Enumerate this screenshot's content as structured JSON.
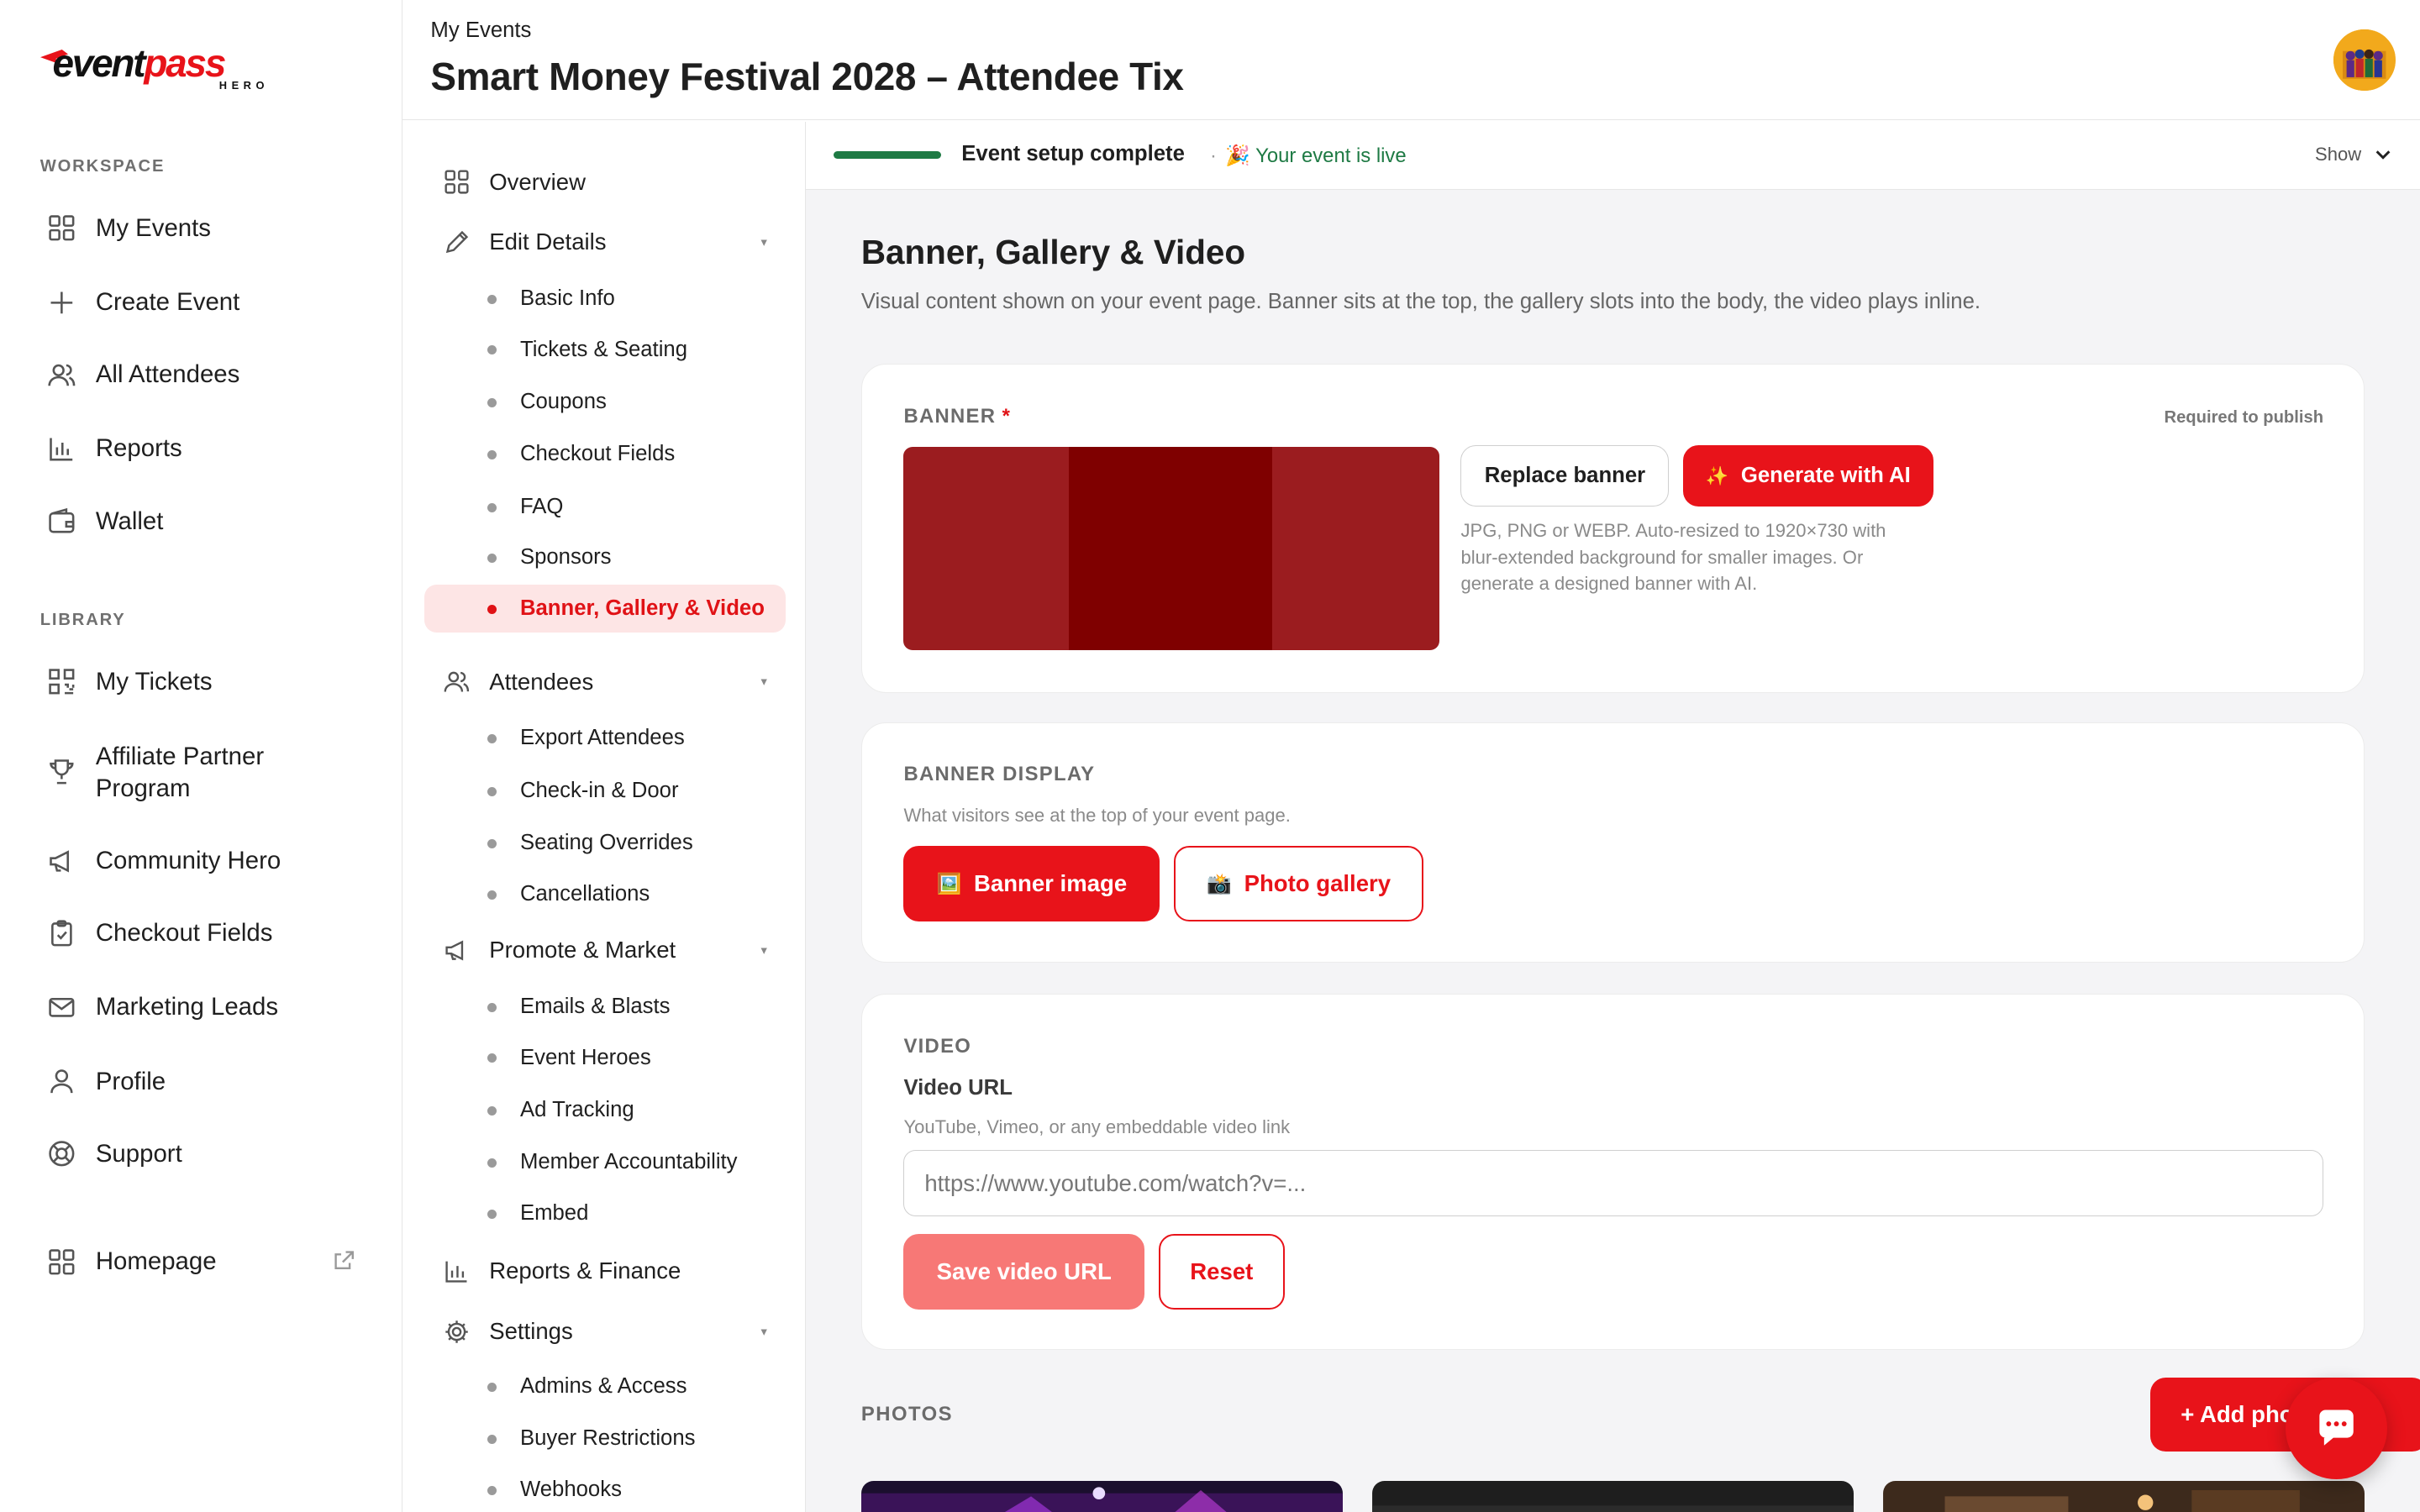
{
  "logo": {
    "part1": "event",
    "part2": "pass",
    "sub": "HERO"
  },
  "sidebar": {
    "workspace_label": "WORKSPACE",
    "workspace_items": [
      {
        "label": "My Events",
        "icon": "grid-icon"
      },
      {
        "label": "Create Event",
        "icon": "plus-icon"
      },
      {
        "label": "All Attendees",
        "icon": "users-icon"
      },
      {
        "label": "Reports",
        "icon": "bar-chart-icon"
      },
      {
        "label": "Wallet",
        "icon": "wallet-icon"
      }
    ],
    "library_label": "LIBRARY",
    "library_items": [
      {
        "label": "My Tickets",
        "icon": "qr-code-icon"
      },
      {
        "label": "Affiliate Partner Program",
        "icon": "trophy-icon"
      },
      {
        "label": "Community Hero",
        "icon": "megaphone-icon"
      },
      {
        "label": "Checkout Fields",
        "icon": "clipboard-check-icon"
      },
      {
        "label": "Marketing Leads",
        "icon": "mail-icon"
      },
      {
        "label": "Profile",
        "icon": "user-icon"
      },
      {
        "label": "Support",
        "icon": "lifebuoy-icon"
      }
    ],
    "homepage": {
      "label": "Homepage",
      "icon": "grid-icon",
      "ext_icon": "external-link-icon"
    }
  },
  "header": {
    "breadcrumb": "My Events",
    "title": "Smart Money Festival 2028 – Attendee Tix"
  },
  "subnav": {
    "overview": "Overview",
    "edit_details": {
      "label": "Edit Details",
      "items": [
        "Basic Info",
        "Tickets & Seating",
        "Coupons",
        "Checkout Fields",
        "FAQ",
        "Sponsors",
        "Banner, Gallery & Video"
      ],
      "active": "Banner, Gallery & Video"
    },
    "attendees": {
      "label": "Attendees",
      "items": [
        "Export Attendees",
        "Check-in & Door",
        "Seating Overrides",
        "Cancellations"
      ]
    },
    "promote": {
      "label": "Promote & Market",
      "items": [
        "Emails & Blasts",
        "Event Heroes",
        "Ad Tracking",
        "Member Accountability",
        "Embed"
      ]
    },
    "reports": "Reports & Finance",
    "settings": {
      "label": "Settings",
      "items": [
        "Admins & Access",
        "Buyer Restrictions",
        "Webhooks"
      ]
    },
    "caret": "▾"
  },
  "status": {
    "progress": 1.0,
    "text": "Event setup complete",
    "live_prefix": "·",
    "live_emoji": "🎉",
    "live_text": "Your event is live",
    "show_label": "Show"
  },
  "main": {
    "title": "Banner, Gallery & Video",
    "lead": "Visual content shown on your event page. Banner sits at the top, the gallery slots into the body, the video plays inline."
  },
  "banner_card": {
    "label": "BANNER",
    "required_star": "*",
    "required_note": "Required to publish",
    "replace_label": "Replace banner",
    "generate_label": "Generate with AI",
    "generate_icon": "✨",
    "help": "JPG, PNG or WEBP. Auto-resized to 1920×730 with blur-extended background for smaller images. Or generate a designed banner with AI.",
    "preview_colors": [
      "#9b1c1f",
      "#7f0000"
    ]
  },
  "display_card": {
    "label": "BANNER DISPLAY",
    "help": "What visitors see at the top of your event page.",
    "option_image": {
      "icon": "🖼️",
      "label": "Banner image"
    },
    "option_gallery": {
      "icon": "📸",
      "label": "Photo gallery"
    }
  },
  "video_card": {
    "label": "VIDEO",
    "field_label": "Video URL",
    "field_help": "YouTube, Vimeo, or any embeddable video link",
    "placeholder": "https://www.youtube.com/watch?v=...",
    "save_label": "Save video URL",
    "reset_label": "Reset"
  },
  "photos": {
    "label": "PHOTOS",
    "add_label": "+ Add photo"
  },
  "colors": {
    "accent": "#e8131a",
    "success": "#1e7a44",
    "active_bg": "#fde5e5"
  }
}
